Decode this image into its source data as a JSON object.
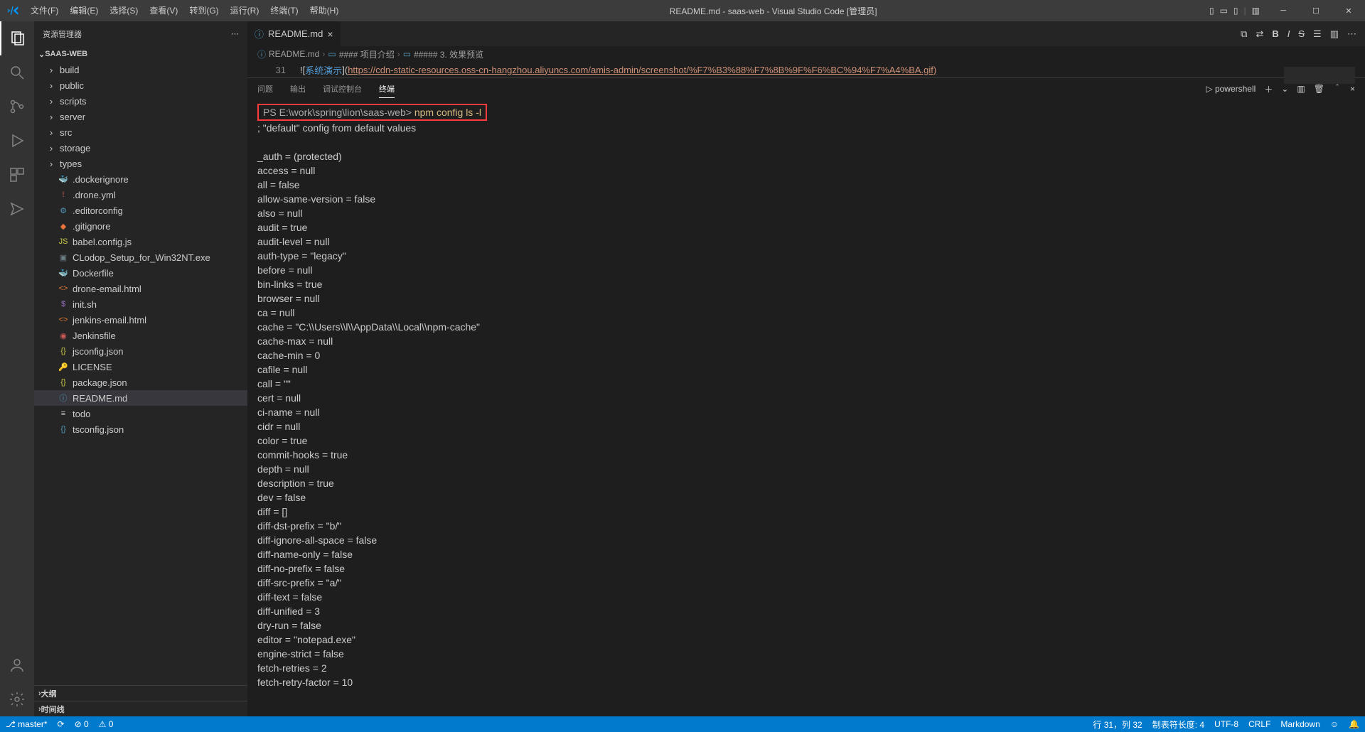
{
  "title": "README.md - saas-web - Visual Studio Code [管理员]",
  "menu": [
    "文件(F)",
    "编辑(E)",
    "选择(S)",
    "查看(V)",
    "转到(G)",
    "运行(R)",
    "终端(T)",
    "帮助(H)"
  ],
  "explorer_label": "资源管理器",
  "root_name": "SAAS-WEB",
  "folders": [
    "build",
    "public",
    "scripts",
    "server",
    "src",
    "storage",
    "types"
  ],
  "files": [
    {
      "name": ".dockerignore",
      "icon": "docker",
      "color": "#6a9955"
    },
    {
      "name": ".drone.yml",
      "icon": "yml",
      "color": "#cf5b56"
    },
    {
      "name": ".editorconfig",
      "icon": "gear",
      "color": "#519aba"
    },
    {
      "name": ".gitignore",
      "icon": "git",
      "color": "#e8743b"
    },
    {
      "name": "babel.config.js",
      "icon": "js",
      "color": "#cbcb41"
    },
    {
      "name": "CLodop_Setup_for_Win32NT.exe",
      "icon": "exe",
      "color": "#6d8086"
    },
    {
      "name": "Dockerfile",
      "icon": "docker",
      "color": "#519aba"
    },
    {
      "name": "drone-email.html",
      "icon": "html",
      "color": "#e37933"
    },
    {
      "name": "init.sh",
      "icon": "sh",
      "color": "#a074c4"
    },
    {
      "name": "jenkins-email.html",
      "icon": "html",
      "color": "#e37933"
    },
    {
      "name": "Jenkinsfile",
      "icon": "jenkins",
      "color": "#cf5b56"
    },
    {
      "name": "jsconfig.json",
      "icon": "json",
      "color": "#cbcb41"
    },
    {
      "name": "LICENSE",
      "icon": "cert",
      "color": "#cbcb41"
    },
    {
      "name": "package.json",
      "icon": "json",
      "color": "#cbcb41"
    },
    {
      "name": "README.md",
      "icon": "info",
      "color": "#519aba",
      "selected": true
    },
    {
      "name": "todo",
      "icon": "file",
      "color": "#ccc"
    },
    {
      "name": "tsconfig.json",
      "icon": "json",
      "color": "#519aba"
    }
  ],
  "outline_label": "大纲",
  "timeline_label": "时间线",
  "tab": {
    "name": "README.md",
    "icon_color": "#519aba"
  },
  "breadcrumb": [
    "README.md",
    "#### 项目介绍",
    "##### 3. 效果预览"
  ],
  "editor": {
    "line_no": "31",
    "prefix": "![",
    "link_text": "系统演示",
    "mid": "](",
    "url": "https://cdn-static-resources.oss-cn-hangzhou.aliyuncs.com/amis-admin/screenshot/%F7%B3%88%F7%8B%9F%F6%BC%94%F7%A4%BA.gif)",
    "suffix": ""
  },
  "panel_tabs": {
    "problems": "问题",
    "output": "输出",
    "debug": "调试控制台",
    "terminal": "终端"
  },
  "terminal_shell": "powershell",
  "terminal": {
    "prompt": "PS E:\\work\\spring\\lion\\saas-web>",
    "command": "npm config ls -l",
    "comment": "; \"default\" config from default values",
    "lines": [
      "_auth = (protected)",
      "access = null",
      "all = false",
      "allow-same-version = false",
      "also = null",
      "audit = true",
      "audit-level = null",
      "auth-type = \"legacy\"",
      "before = null",
      "bin-links = true",
      "browser = null",
      "ca = null",
      "cache = \"C:\\\\Users\\\\l\\\\AppData\\\\Local\\\\npm-cache\"",
      "cache-max = null",
      "cache-min = 0",
      "cafile = null",
      "call = \"\"",
      "cert = null",
      "ci-name = null",
      "cidr = null",
      "color = true",
      "commit-hooks = true",
      "depth = null",
      "description = true",
      "dev = false",
      "diff = []",
      "diff-dst-prefix = \"b/\"",
      "diff-ignore-all-space = false",
      "diff-name-only = false",
      "diff-no-prefix = false",
      "diff-src-prefix = \"a/\"",
      "diff-text = false",
      "diff-unified = 3",
      "dry-run = false",
      "editor = \"notepad.exe\"",
      "engine-strict = false",
      "fetch-retries = 2",
      "fetch-retry-factor = 10"
    ]
  },
  "status": {
    "branch": "master",
    "sync": "⟳",
    "errors": "⊘ 0",
    "warnings": "⚠ 0",
    "cursor": "行 31，列 32",
    "tabsize": "制表符长度: 4",
    "encoding": "UTF-8",
    "eol": "CRLF",
    "lang": "Markdown",
    "feedback": "☺",
    "bell": "🔔"
  }
}
